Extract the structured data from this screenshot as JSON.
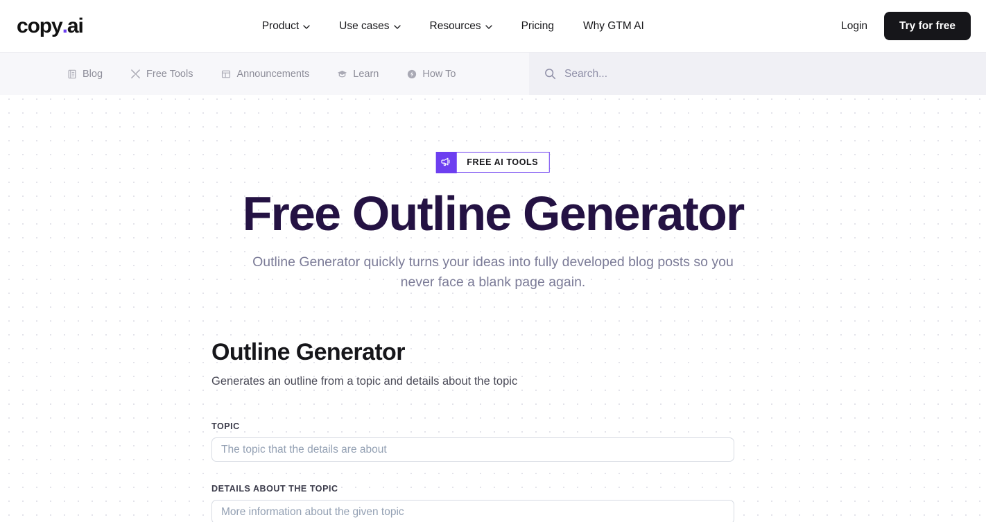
{
  "brand": {
    "logo_text": "copy",
    "logo_dot": ".",
    "logo_suffix": "ai",
    "accent_purple": "#6d3ff0",
    "heading_navy": "#241243",
    "dark_button": "#16161a"
  },
  "topnav": {
    "items": [
      {
        "label": "Product",
        "has_chevron": true,
        "icon": "chevron-down-icon"
      },
      {
        "label": "Use cases",
        "has_chevron": true,
        "icon": "chevron-down-icon"
      },
      {
        "label": "Resources",
        "has_chevron": true,
        "icon": "chevron-down-icon"
      },
      {
        "label": "Pricing",
        "has_chevron": false
      },
      {
        "label": "Why GTM AI",
        "has_chevron": false
      }
    ],
    "login_label": "Login",
    "cta_label": "Try for free"
  },
  "subnav": {
    "items": [
      {
        "label": "Blog",
        "icon": "book-icon"
      },
      {
        "label": "Free Tools",
        "icon": "tools-icon"
      },
      {
        "label": "Announcements",
        "icon": "announcement-icon"
      },
      {
        "label": "Learn",
        "icon": "graduation-cap-icon"
      },
      {
        "label": "How To",
        "icon": "info-circle-icon"
      }
    ],
    "search": {
      "icon": "search-icon",
      "placeholder": "Search...",
      "value": ""
    }
  },
  "hero": {
    "badge": {
      "icon": "megaphone-icon",
      "label": "FREE AI TOOLS"
    },
    "title": "Free Outline Generator",
    "subtitle": "Outline Generator quickly turns your ideas into fully developed blog posts so you never face a blank page again."
  },
  "tool": {
    "title": "Outline Generator",
    "description": "Generates an outline from a topic and details about the topic",
    "fields": [
      {
        "label": "TOPIC",
        "placeholder": "The topic that the details are about",
        "value": ""
      },
      {
        "label": "DETAILS ABOUT THE TOPIC",
        "placeholder": "More information about the given topic",
        "value": ""
      }
    ]
  }
}
